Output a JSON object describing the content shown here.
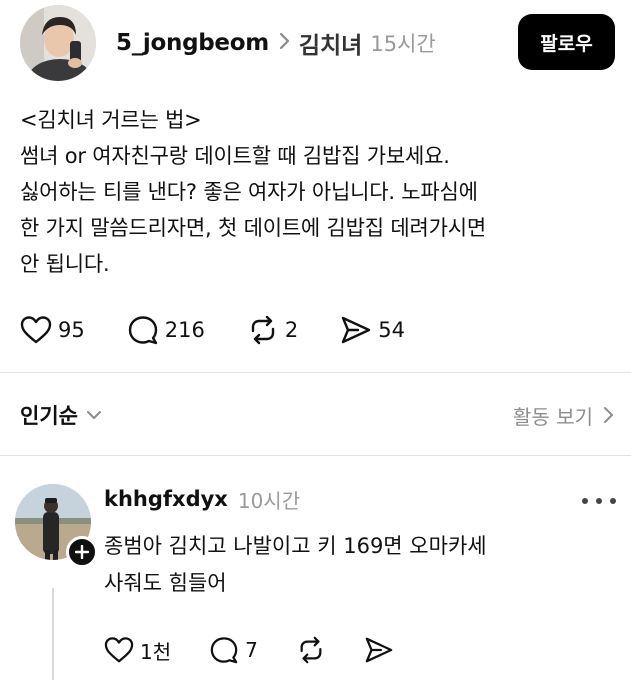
{
  "post": {
    "avatar_icon": "user-avatar-selfie",
    "username": "5_jongbeom",
    "separator_icon": "chevron-right-icon",
    "topic": "김치녀",
    "time": "15시간",
    "follow_label": "팔로우",
    "body_lines": [
      "<김치녀 거르는 법>",
      "썸녀 or 여자친구랑 데이트할 때 김밥집 가보세요.",
      "싫어하는 티를 낸다? 좋은 여자가 아닙니다. 노파심에",
      "한 가지 말씀드리자면, 첫 데이트에 김밥집 데려가시면",
      "안 됩니다."
    ],
    "likes": "95",
    "comments": "216",
    "reposts": "2",
    "shares": "54"
  },
  "sort_bar": {
    "sort_label": "인기순",
    "activity_label": "활동 보기"
  },
  "reply": {
    "avatar_icon": "user-avatar-outdoor",
    "username": "khhgfxdyx",
    "time": "10시간",
    "body_lines": [
      "종범아 김치고 나발이고 키 169면 오마카세",
      "사줘도 힘들어"
    ],
    "likes": "1천",
    "comments": "7"
  },
  "colors": {
    "follow_bg": "#000000",
    "muted": "#9a9a9a",
    "divider": "#e2e2e2"
  }
}
